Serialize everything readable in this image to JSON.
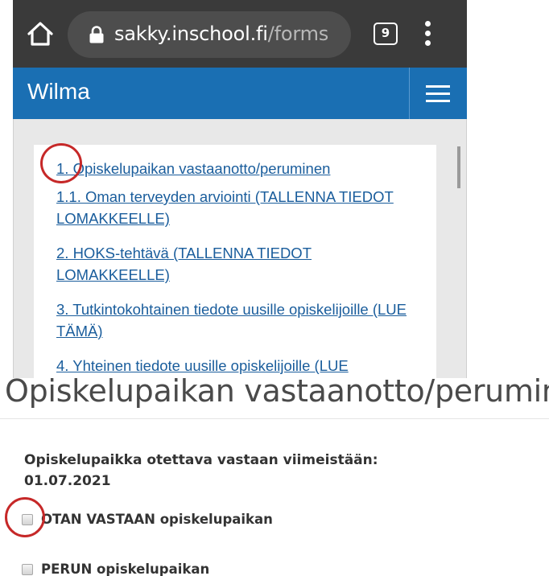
{
  "browser": {
    "url_host": "sakky.inschool.fi",
    "url_path": "/forms",
    "tab_count": "9",
    "icons": [
      "home-icon",
      "lock-icon",
      "tabs-icon",
      "more-vert-icon"
    ]
  },
  "app": {
    "title": "Wilma",
    "menu_icon": "hamburger-icon",
    "brand_color": "#1a6fb3"
  },
  "form_list": {
    "links": [
      "1. Opiskelupaikan vastaanotto/peruminen",
      "1.1. Oman terveyden arviointi (TALLENNA TIEDOT LOMAKKEELLE)",
      "2. HOKS-tehtävä (TALLENNA TIEDOT LOMAKKEELLE)",
      "3. Tutkintokohtainen tiedote uusille opiskelijoille (LUE TÄMÄ)",
      "4. Yhteinen tiedote uusille opiskelijoille (LUE"
    ],
    "link_color": "#1a5d9c"
  },
  "form": {
    "title": "Opiskelupaikan vastaanotto/peruminen",
    "deadline_label": "Opiskelupaikka otettava vastaan viimeistään:",
    "deadline_value": "01.07.2021",
    "options": [
      {
        "label": "OTAN VASTAAN opiskelupaikan",
        "checked": false
      },
      {
        "label": "PERUN opiskelupaikan",
        "checked": false
      }
    ]
  },
  "annotations": {
    "highlight_color": "#c62828"
  }
}
